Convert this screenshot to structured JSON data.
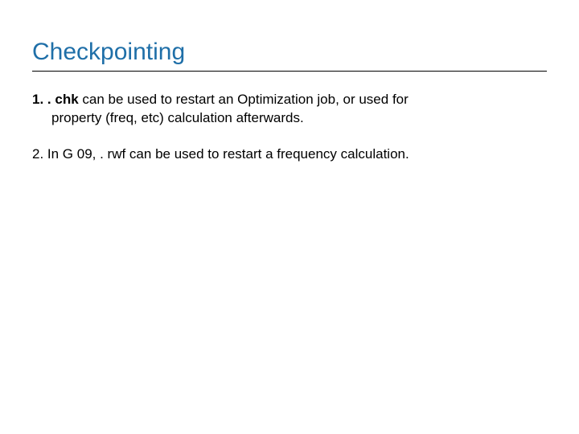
{
  "title": "Checkpointing",
  "items": {
    "one": {
      "num": "1.",
      "bold": ". chk",
      "line1rest": " can be used to restart an Optimization job, or used for",
      "line2": "property (freq, etc) calculation afterwards."
    },
    "two": {
      "text": "2. In G 09, . rwf can be used to restart a frequency calculation."
    }
  }
}
